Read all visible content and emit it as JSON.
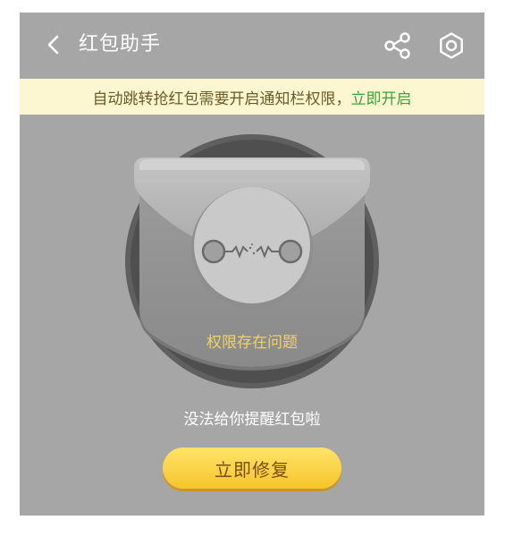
{
  "header": {
    "title": "红包助手",
    "back_icon": "chevron-left-icon",
    "share_icon": "share-icon",
    "settings_icon": "gear-icon"
  },
  "notice": {
    "text": "自动跳转抢红包需要开启通知栏权限，",
    "link": "立即开启"
  },
  "status": {
    "title": "权限存在问题",
    "description": "没法给你提醒红包啦"
  },
  "action": {
    "fix_label": "立即修复"
  },
  "colors": {
    "background": "#a6a6a6",
    "notice_bg": "#fdf7d1",
    "link": "#3aa33a",
    "status_text": "#f1d264",
    "button": "#f6c52b"
  }
}
